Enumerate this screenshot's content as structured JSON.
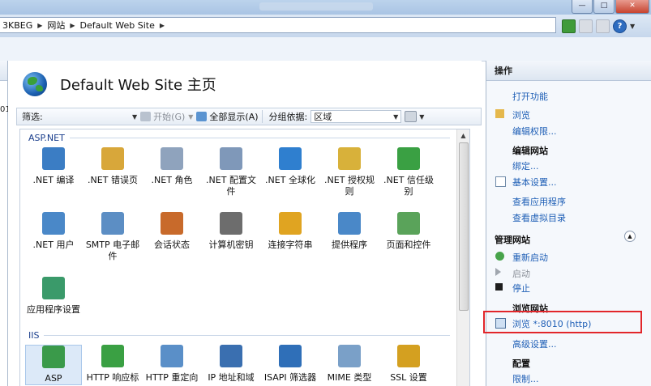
{
  "breadcrumb": [
    "3KBEG",
    "网站",
    "Default Web Site"
  ],
  "page_title": "Default Web Site 主页",
  "filter": {
    "label": "筛选:",
    "start_label": "开始(G)",
    "show_all_label": "全部显示(A)",
    "group_by_label": "分组依据:",
    "group_by_value": "区域"
  },
  "groups": {
    "aspnet": "ASP.NET",
    "iis": "IIS"
  },
  "features_aspnet": [
    {
      "label": ".NET 编译",
      "icon": "dotnet-compile-icon",
      "color": "#3b7dc4"
    },
    {
      "label": ".NET 错误页",
      "icon": "dotnet-error-page-icon",
      "color": "#d8a73a"
    },
    {
      "label": ".NET 角色",
      "icon": "dotnet-roles-icon",
      "color": "#8fa3bd"
    },
    {
      "label": ".NET 配置文件",
      "icon": "dotnet-profile-icon",
      "color": "#7f98b9"
    },
    {
      "label": ".NET 全球化",
      "icon": "dotnet-globalization-icon",
      "color": "#2f7fcf"
    },
    {
      "label": ".NET 授权规则",
      "icon": "dotnet-authorization-icon",
      "color": "#d8b13a"
    },
    {
      "label": ".NET 信任级别",
      "icon": "dotnet-trust-level-icon",
      "color": "#3aa043"
    },
    {
      "label": ".NET 用户",
      "icon": "dotnet-users-icon",
      "color": "#4a88c8"
    },
    {
      "label": "SMTP 电子邮件",
      "icon": "smtp-email-icon",
      "color": "#5c8ec4"
    },
    {
      "label": "会话状态",
      "icon": "session-state-icon",
      "color": "#c86a2b"
    },
    {
      "label": "计算机密钥",
      "icon": "machine-key-icon",
      "color": "#6d6d6d"
    },
    {
      "label": "连接字符串",
      "icon": "connection-strings-icon",
      "color": "#e0a421"
    },
    {
      "label": "提供程序",
      "icon": "providers-icon",
      "color": "#4a88c8"
    },
    {
      "label": "页面和控件",
      "icon": "pages-controls-icon",
      "color": "#5aa35a"
    },
    {
      "label": "应用程序设置",
      "icon": "app-settings-icon",
      "color": "#3a9a6a"
    }
  ],
  "features_iis": [
    {
      "label": "ASP",
      "icon": "asp-icon",
      "color": "#3a9a4a"
    },
    {
      "label": "HTTP 响应标",
      "icon": "http-response-headers-icon",
      "color": "#3aa043"
    },
    {
      "label": "HTTP 重定向",
      "icon": "http-redirect-icon",
      "color": "#5a8fc8"
    },
    {
      "label": "IP 地址和域",
      "icon": "ip-domain-icon",
      "color": "#3a6fb0"
    },
    {
      "label": "ISAPI 筛选器",
      "icon": "isapi-filters-icon",
      "color": "#2f6fb8"
    },
    {
      "label": "MIME 类型",
      "icon": "mime-types-icon",
      "color": "#7aa0c8"
    },
    {
      "label": "SSL 设置",
      "icon": "ssl-settings-icon",
      "color": "#d4a020"
    }
  ],
  "actions": {
    "title": "操作",
    "open_feature": "打开功能",
    "browse": "浏览",
    "edit_permissions": "编辑权限...",
    "edit_site": "编辑网站",
    "bindings": "绑定...",
    "basic_settings": "基本设置...",
    "view_applications": "查看应用程序",
    "view_virtual_dirs": "查看虚拟目录",
    "manage_site": "管理网站",
    "restart": "重新启动",
    "start": "启动",
    "stop": "停止",
    "browse_site": "浏览网站",
    "browse_port": "浏览 *:8010 (http)",
    "advanced_settings": "高级设置...",
    "config": "配置",
    "limits": "限制..."
  },
  "left_tree_fragment": "01",
  "colors": {
    "accent_link": "#1f5fb6",
    "highlight_box": "#e2262a",
    "group_header": "#1a3e8c"
  }
}
